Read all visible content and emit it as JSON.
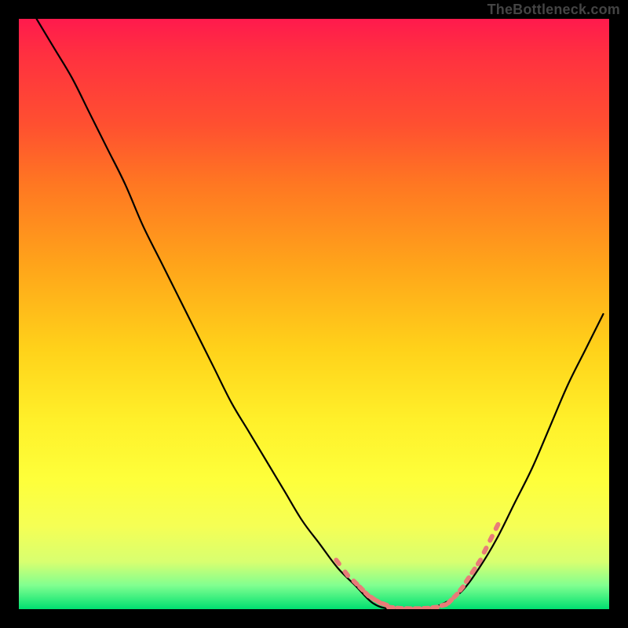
{
  "attribution": "TheBottleneck.com",
  "chart_data": {
    "type": "line",
    "title": "",
    "xlabel": "",
    "ylabel": "",
    "xlim": [
      0,
      100
    ],
    "ylim": [
      0,
      100
    ],
    "grid": false,
    "legend": false,
    "series": [
      {
        "name": "bottleneck-curve",
        "color": "#000000",
        "x": [
          3,
          6,
          9,
          12,
          15,
          18,
          21,
          24,
          27,
          30,
          33,
          36,
          39,
          42,
          45,
          48,
          51,
          54,
          57,
          60,
          63,
          66,
          69,
          72,
          75,
          78,
          81,
          84,
          87,
          90,
          93,
          96,
          99
        ],
        "y": [
          100,
          95,
          90,
          84,
          78,
          72,
          65,
          59,
          53,
          47,
          41,
          35,
          30,
          25,
          20,
          15,
          11,
          7,
          4,
          1,
          0,
          0,
          0,
          1,
          3,
          7,
          12,
          18,
          24,
          31,
          38,
          44,
          50
        ]
      }
    ],
    "markers": [
      {
        "name": "left-dotted-segment",
        "color": "#e97c78",
        "x": [
          54,
          55.5,
          57,
          58,
          59,
          60,
          61,
          62
        ],
        "y": [
          8,
          6,
          4.5,
          3.5,
          2.5,
          1.8,
          1.2,
          0.8
        ]
      },
      {
        "name": "bottom-dotted-segment",
        "color": "#e97c78",
        "x": [
          63,
          64.5,
          66,
          67.5,
          69,
          70.5,
          72
        ],
        "y": [
          0.3,
          0.15,
          0.1,
          0.1,
          0.15,
          0.3,
          0.7
        ]
      },
      {
        "name": "right-dotted-segment",
        "color": "#e97c78",
        "x": [
          73,
          74,
          75,
          76,
          77,
          78,
          79,
          80,
          81
        ],
        "y": [
          1.3,
          2.3,
          3.5,
          5,
          6.5,
          8,
          10,
          12,
          14
        ]
      }
    ]
  }
}
